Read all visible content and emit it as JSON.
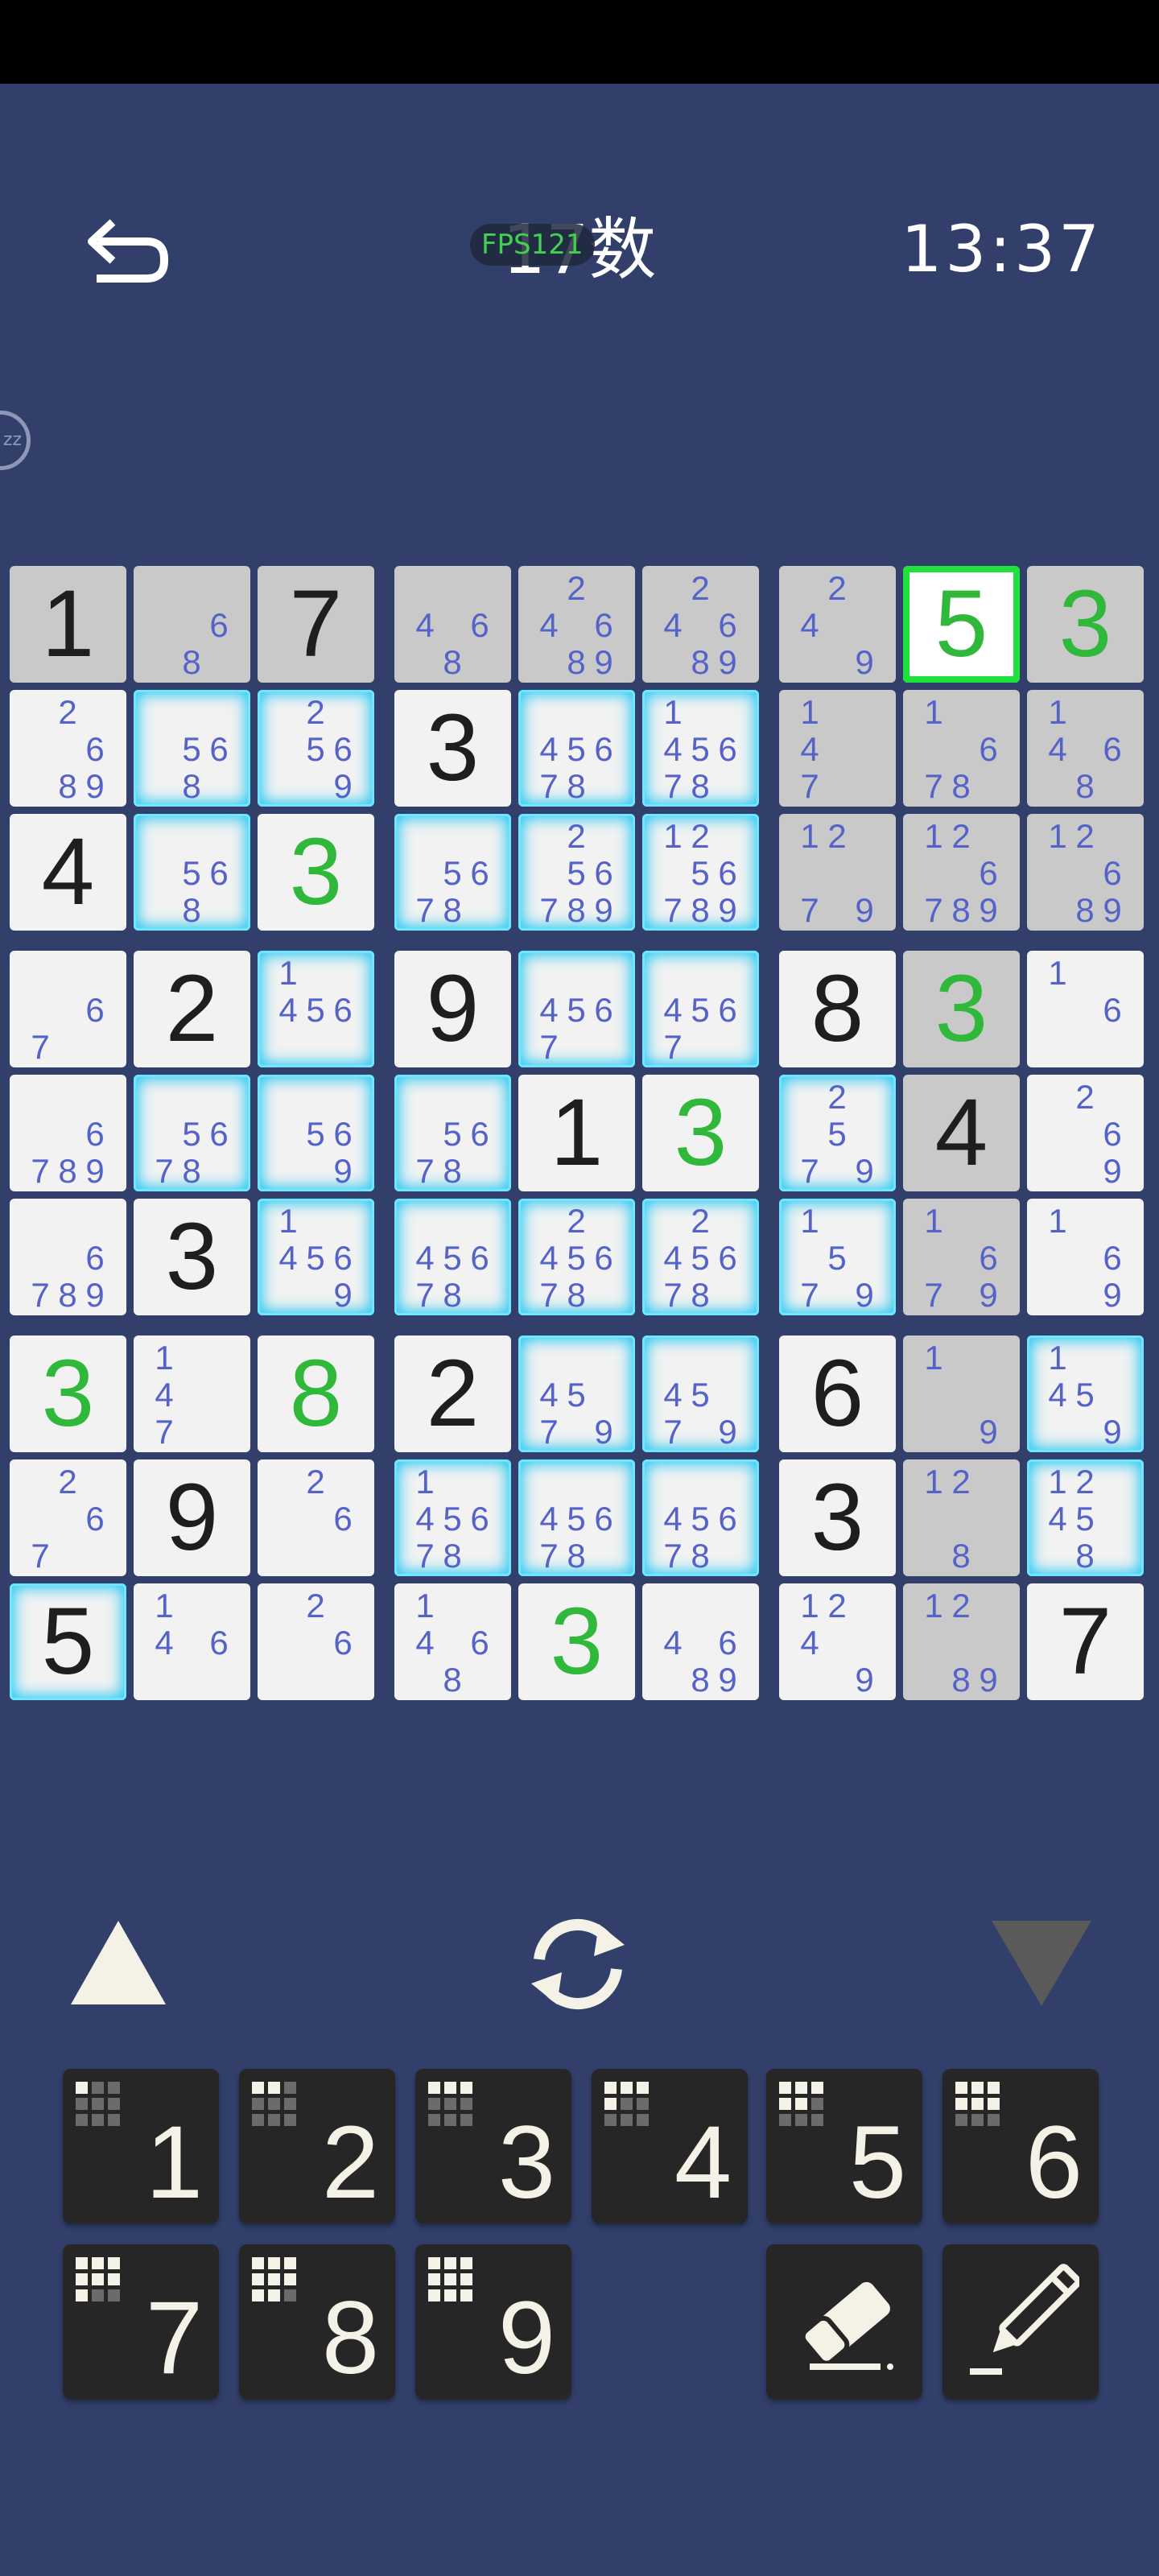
{
  "header": {
    "title": "17数",
    "fps": "FPS121",
    "timer": "13:37",
    "sleep_label": "zz"
  },
  "board": {
    "cells": [
      [
        {
          "v": "1",
          "s": 1
        },
        {
          "c": [
            6,
            8
          ],
          "s": 1
        },
        {
          "v": "7",
          "s": 1
        },
        {
          "c": [
            4,
            6,
            8
          ],
          "s": 1
        },
        {
          "c": [
            2,
            4,
            6,
            8,
            9
          ],
          "s": 1
        },
        {
          "c": [
            2,
            4,
            6,
            8,
            9
          ],
          "s": 1
        },
        {
          "c": [
            2,
            4,
            9
          ],
          "s": 1
        },
        {
          "v": "5",
          "g": 1,
          "sel": 1
        },
        {
          "v": "3",
          "g": 1,
          "s": 1
        }
      ],
      [
        {
          "c": [
            2,
            6,
            8,
            9
          ]
        },
        {
          "c": [
            5,
            6,
            8
          ],
          "h": 1
        },
        {
          "c": [
            2,
            5,
            6,
            9
          ],
          "h": 1
        },
        {
          "v": "3"
        },
        {
          "c": [
            4,
            5,
            6,
            7,
            8
          ],
          "h": 1
        },
        {
          "c": [
            1,
            4,
            5,
            6,
            7,
            8
          ],
          "h": 1
        },
        {
          "c": [
            1,
            4,
            7
          ],
          "s": 1
        },
        {
          "c": [
            1,
            6,
            7,
            8
          ],
          "s": 1
        },
        {
          "c": [
            1,
            4,
            6,
            8
          ],
          "s": 1
        }
      ],
      [
        {
          "v": "4"
        },
        {
          "c": [
            5,
            6,
            8
          ],
          "h": 1
        },
        {
          "v": "3",
          "g": 1
        },
        {
          "c": [
            5,
            6,
            7,
            8
          ],
          "h": 1
        },
        {
          "c": [
            2,
            5,
            6,
            7,
            8,
            9
          ],
          "h": 1
        },
        {
          "c": [
            1,
            2,
            5,
            6,
            7,
            8,
            9
          ],
          "h": 1
        },
        {
          "c": [
            1,
            2,
            7,
            9
          ],
          "s": 1
        },
        {
          "c": [
            1,
            2,
            6,
            7,
            8,
            9
          ],
          "s": 1
        },
        {
          "c": [
            1,
            2,
            6,
            8,
            9
          ],
          "s": 1
        }
      ],
      [
        {
          "c": [
            6,
            7
          ]
        },
        {
          "v": "2"
        },
        {
          "c": [
            1,
            4,
            5,
            6
          ],
          "h": 1
        },
        {
          "v": "9"
        },
        {
          "c": [
            4,
            5,
            6,
            7
          ],
          "h": 1
        },
        {
          "c": [
            4,
            5,
            6,
            7
          ],
          "h": 1
        },
        {
          "v": "8"
        },
        {
          "v": "3",
          "g": 1,
          "s": 1
        },
        {
          "c": [
            1,
            6
          ]
        }
      ],
      [
        {
          "c": [
            6,
            7,
            8,
            9
          ]
        },
        {
          "c": [
            5,
            6,
            7,
            8
          ],
          "h": 1
        },
        {
          "c": [
            5,
            6,
            9
          ],
          "h": 1
        },
        {
          "c": [
            5,
            6,
            7,
            8
          ],
          "h": 1
        },
        {
          "v": "1"
        },
        {
          "v": "3",
          "g": 1
        },
        {
          "c": [
            2,
            5,
            7,
            9
          ],
          "h": 1
        },
        {
          "v": "4",
          "s": 1
        },
        {
          "c": [
            2,
            6,
            9
          ]
        }
      ],
      [
        {
          "c": [
            6,
            7,
            8,
            9
          ]
        },
        {
          "v": "3"
        },
        {
          "c": [
            1,
            4,
            5,
            6,
            9
          ],
          "h": 1
        },
        {
          "c": [
            4,
            5,
            6,
            7,
            8
          ],
          "h": 1
        },
        {
          "c": [
            2,
            4,
            5,
            6,
            7,
            8
          ],
          "h": 1
        },
        {
          "c": [
            2,
            4,
            5,
            6,
            7,
            8
          ],
          "h": 1
        },
        {
          "c": [
            1,
            5,
            7,
            9
          ],
          "h": 1
        },
        {
          "c": [
            1,
            6,
            7,
            9
          ],
          "s": 1
        },
        {
          "c": [
            1,
            6,
            9
          ]
        }
      ],
      [
        {
          "v": "3",
          "g": 1
        },
        {
          "c": [
            1,
            4,
            7
          ]
        },
        {
          "v": "8",
          "g": 1
        },
        {
          "v": "2"
        },
        {
          "c": [
            4,
            5,
            7,
            9
          ],
          "h": 1
        },
        {
          "c": [
            4,
            5,
            7,
            9
          ],
          "h": 1
        },
        {
          "v": "6"
        },
        {
          "c": [
            1,
            9
          ],
          "s": 1
        },
        {
          "c": [
            1,
            4,
            5,
            9
          ],
          "h": 1
        }
      ],
      [
        {
          "c": [
            2,
            6,
            7
          ]
        },
        {
          "v": "9"
        },
        {
          "c": [
            2,
            6
          ]
        },
        {
          "c": [
            1,
            4,
            5,
            6,
            7,
            8
          ],
          "h": 1
        },
        {
          "c": [
            4,
            5,
            6,
            7,
            8
          ],
          "h": 1
        },
        {
          "c": [
            4,
            5,
            6,
            7,
            8
          ],
          "h": 1
        },
        {
          "v": "3"
        },
        {
          "c": [
            1,
            2,
            8
          ],
          "s": 1
        },
        {
          "c": [
            1,
            2,
            4,
            5,
            8
          ],
          "h": 1
        }
      ],
      [
        {
          "v": "5",
          "h": 1
        },
        {
          "c": [
            1,
            4,
            6
          ]
        },
        {
          "c": [
            2,
            6
          ]
        },
        {
          "c": [
            1,
            4,
            6,
            8
          ]
        },
        {
          "v": "3",
          "g": 1
        },
        {
          "c": [
            4,
            6,
            8,
            9
          ]
        },
        {
          "c": [
            1,
            2,
            4,
            9
          ]
        },
        {
          "c": [
            1,
            2,
            8,
            9
          ],
          "s": 1
        },
        {
          "v": "7"
        }
      ]
    ]
  },
  "controls": {
    "up_icon": "triangle-up-icon",
    "refresh_icon": "refresh-icon",
    "down_icon": "triangle-down-icon"
  },
  "keypad": {
    "keys": [
      "1",
      "2",
      "3",
      "4",
      "5",
      "6",
      "7",
      "8",
      "9"
    ],
    "eraser_icon": "eraser-icon",
    "pencil_icon": "pencil-icon"
  },
  "colors": {
    "background": "#323f6a",
    "candidate": "#5563c9",
    "given_green": "#2fb83a",
    "highlight": "#28c8f2",
    "selected_border": "#1fe13b"
  }
}
